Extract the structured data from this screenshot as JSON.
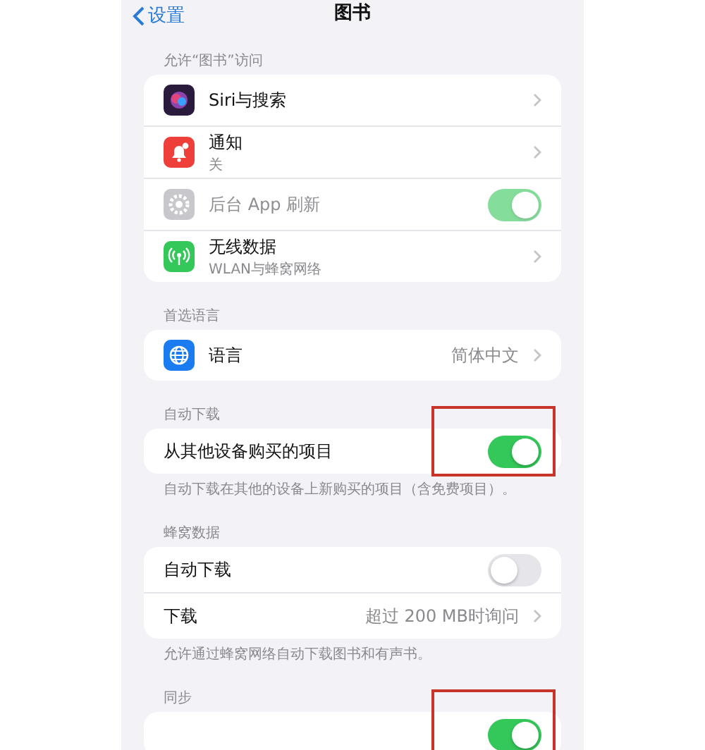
{
  "nav": {
    "back": "设置",
    "title": "图书"
  },
  "sections": [
    {
      "header": "允许“图书”访问",
      "rows": [
        {
          "kind": "link",
          "label": "Siri与搜索"
        },
        {
          "kind": "link",
          "label": "通知",
          "subtitle": "关"
        },
        {
          "kind": "toggle",
          "label": "后台 App 刷新",
          "on": true,
          "disabled": true
        },
        {
          "kind": "link",
          "label": "无线数据",
          "subtitle": "WLAN与蜂窝网络"
        }
      ]
    },
    {
      "header": "首选语言",
      "rows": [
        {
          "kind": "link",
          "label": "语言",
          "value": "简体中文"
        }
      ]
    },
    {
      "header": "自动下载",
      "rows": [
        {
          "kind": "toggle",
          "label": "从其他设备购买的项目",
          "on": true,
          "highlighted": true
        }
      ],
      "footer": "自动下载在其他的设备上新购买的项目（含免费项目）。"
    },
    {
      "header": "蜂窝数据",
      "rows": [
        {
          "kind": "toggle",
          "label": "自动下载",
          "on": false
        },
        {
          "kind": "link",
          "label": "下载",
          "value": "超过 200 MB时询问"
        }
      ],
      "footer": "允许通过蜂窝网络自动下载图书和有声书。"
    },
    {
      "header": "同步",
      "rows": [
        {
          "kind": "toggle",
          "on": true,
          "highlighted": true
        }
      ]
    }
  ]
}
